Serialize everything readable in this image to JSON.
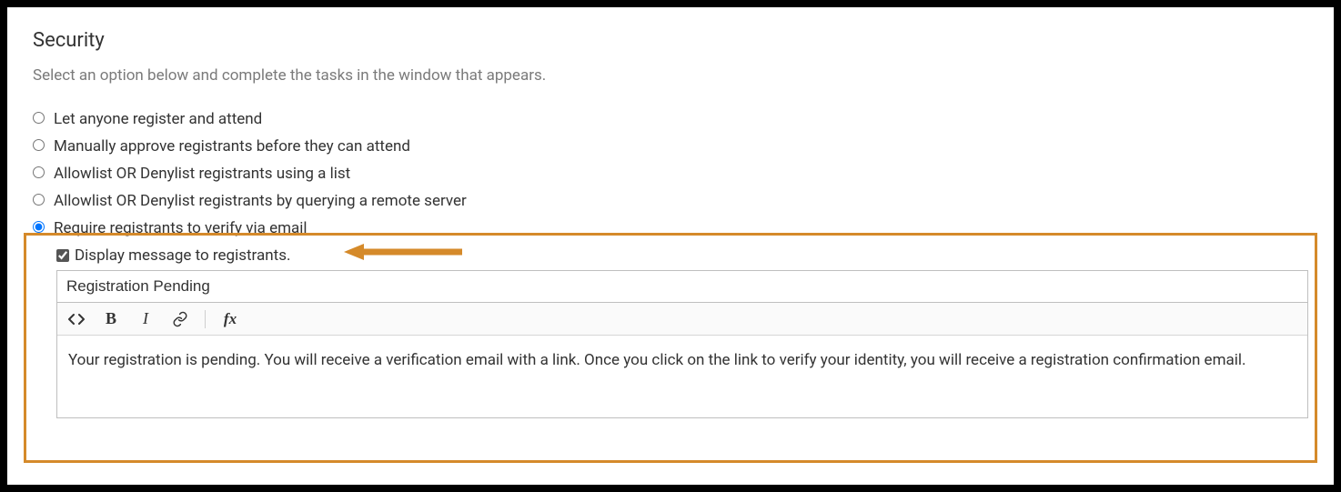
{
  "section": {
    "title": "Security",
    "description": "Select an option below and complete the tasks in the window that appears."
  },
  "options": {
    "anyone": "Let anyone register and attend",
    "manual": "Manually approve registrants before they can attend",
    "list": "Allowlist OR Denylist registrants using a list",
    "remote": "Allowlist OR Denylist registrants by querying a remote server",
    "verify": "Require registrants to verify via email"
  },
  "verify_block": {
    "display_message_label": "Display message to registrants.",
    "title_value": "Registration Pending",
    "body_text": "Your registration is pending. You will receive a verification email with a link. Once you click on the link to verify your identity, you will receive a registration confirmation email."
  },
  "colors": {
    "highlight": "#d58a2a"
  }
}
